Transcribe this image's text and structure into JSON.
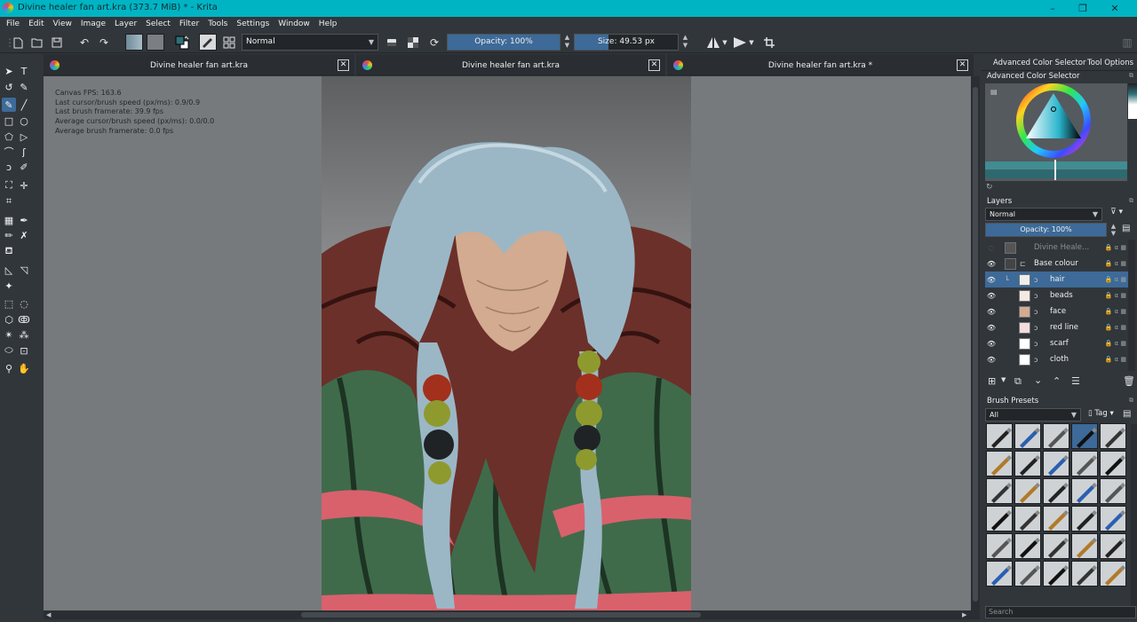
{
  "window": {
    "title": "Divine healer fan art.kra (373.7 MiB)  * - Krita",
    "controls": [
      "–",
      "❐",
      "✕"
    ]
  },
  "menu": [
    "File",
    "Edit",
    "View",
    "Image",
    "Layer",
    "Select",
    "Filter",
    "Tools",
    "Settings",
    "Window",
    "Help"
  ],
  "toolbar": {
    "blend_mode": "Normal",
    "opacity": "Opacity: 100%",
    "opacity_fraction": 1.0,
    "size": "Size: 49.53 px",
    "size_fraction": 0.33
  },
  "tabs": [
    {
      "name": "Divine healer fan art.kra"
    },
    {
      "name": "Divine healer fan art.kra"
    },
    {
      "name": "Divine healer fan art.kra *"
    }
  ],
  "hud": [
    "Canvas FPS: 163.6",
    "Last cursor/brush speed (px/ms): 0.9/0.9",
    "Last brush framerate: 39.9 fps",
    "Average cursor/brush speed (px/ms): 0.0/0.0",
    "Average brush framerate: 0.0 fps"
  ],
  "docker": {
    "tabs": [
      "Advanced Color Selector",
      "Tool Options"
    ],
    "color_selector_title": "Advanced Color Selector",
    "layers_title": "Layers",
    "layers_blend": "Normal",
    "layers_opacity": "Opacity:  100%",
    "layers": [
      {
        "name": "Divine Heale...",
        "visible": false,
        "indent": 0,
        "selected": false,
        "dim": true
      },
      {
        "name": "Base colour",
        "visible": true,
        "indent": 0,
        "selected": false,
        "dim": false
      },
      {
        "name": "hair",
        "visible": true,
        "indent": 1,
        "selected": true,
        "dim": false
      },
      {
        "name": "beads",
        "visible": true,
        "indent": 1,
        "selected": false,
        "dim": false
      },
      {
        "name": "face",
        "visible": true,
        "indent": 1,
        "selected": false,
        "dim": false
      },
      {
        "name": "red line",
        "visible": true,
        "indent": 1,
        "selected": false,
        "dim": false
      },
      {
        "name": "scarf",
        "visible": true,
        "indent": 1,
        "selected": false,
        "dim": false
      },
      {
        "name": "cloth",
        "visible": true,
        "indent": 1,
        "selected": false,
        "dim": false
      }
    ],
    "presets_title": "Brush Presets",
    "presets_filter": "All",
    "presets_tag": "Tag",
    "search_placeholder": "Search"
  },
  "colors": {
    "titlebar": "#00b4c4",
    "accent": "#3d6a98",
    "hair": "#9bb7c6",
    "scarf": "#6b3029",
    "cloth": "#3f6b4b",
    "skin": "#d2ab90",
    "ribbon": "#d9616c"
  }
}
